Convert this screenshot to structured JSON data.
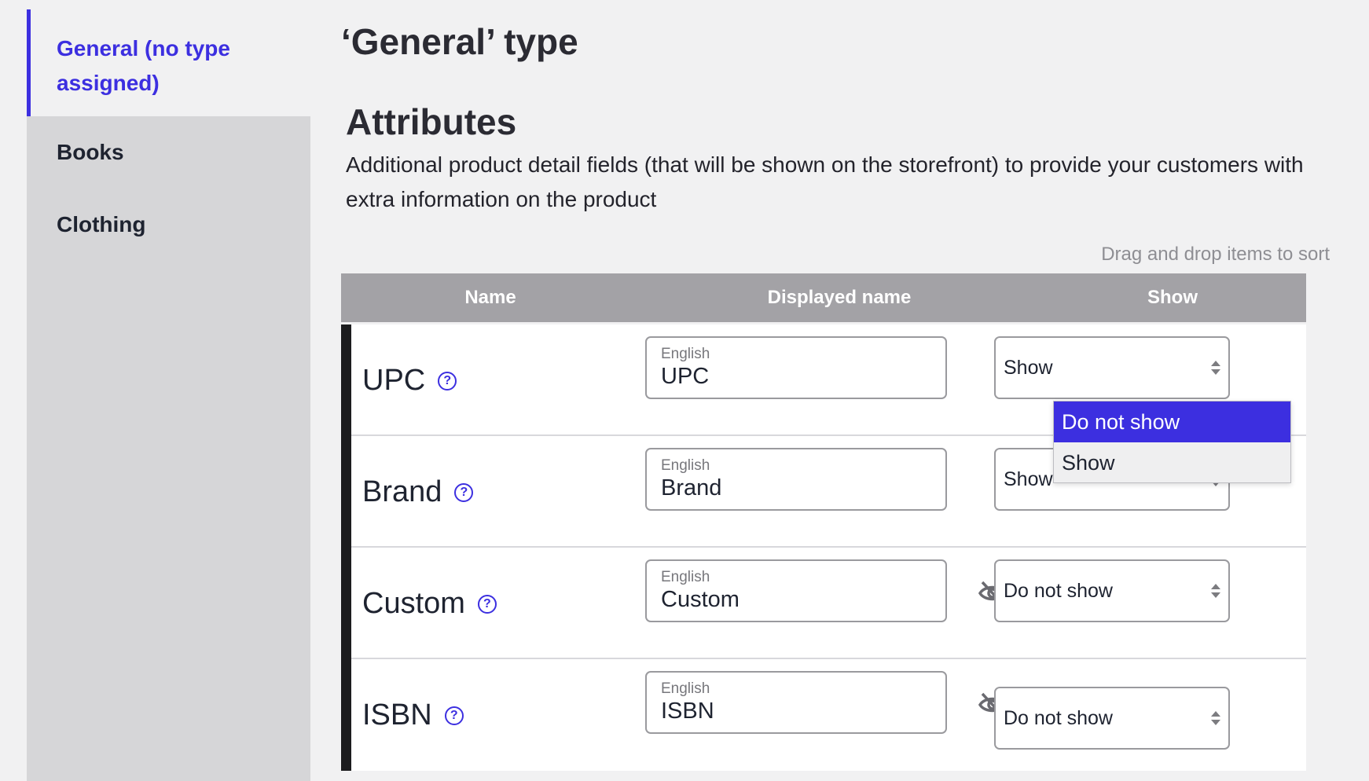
{
  "sidebar": {
    "items": [
      {
        "label": "General (no type assigned)"
      },
      {
        "label": "Books"
      },
      {
        "label": "Clothing"
      }
    ]
  },
  "main": {
    "type_title": "‘General’ type",
    "attributes_title": "Attributes",
    "attributes_description": "Additional product detail fields (that will be shown on the storefront) to provide your customers with extra information on the product",
    "drag_hint": "Drag and drop items to sort"
  },
  "table": {
    "headers": {
      "name": "Name",
      "displayed_name": "Displayed name",
      "show": "Show"
    },
    "rows": [
      {
        "name": "UPC",
        "language": "English",
        "displayed_name": "UPC",
        "show": "Show",
        "hidden": false
      },
      {
        "name": "Brand",
        "language": "English",
        "displayed_name": "Brand",
        "show": "Show",
        "hidden": false
      },
      {
        "name": "Custom",
        "language": "English",
        "displayed_name": "Custom",
        "show": "Do not show",
        "hidden": true
      },
      {
        "name": "ISBN",
        "language": "English",
        "displayed_name": "ISBN",
        "show": "Do not show",
        "hidden": true
      }
    ]
  },
  "dropdown": {
    "options": [
      "Do not show",
      "Show"
    ],
    "highlighted": "Do not show"
  },
  "colors": {
    "accent": "#3c2fe0",
    "header_bg": "#a3a2a6",
    "sidebar_bg": "#d6d6d8"
  }
}
